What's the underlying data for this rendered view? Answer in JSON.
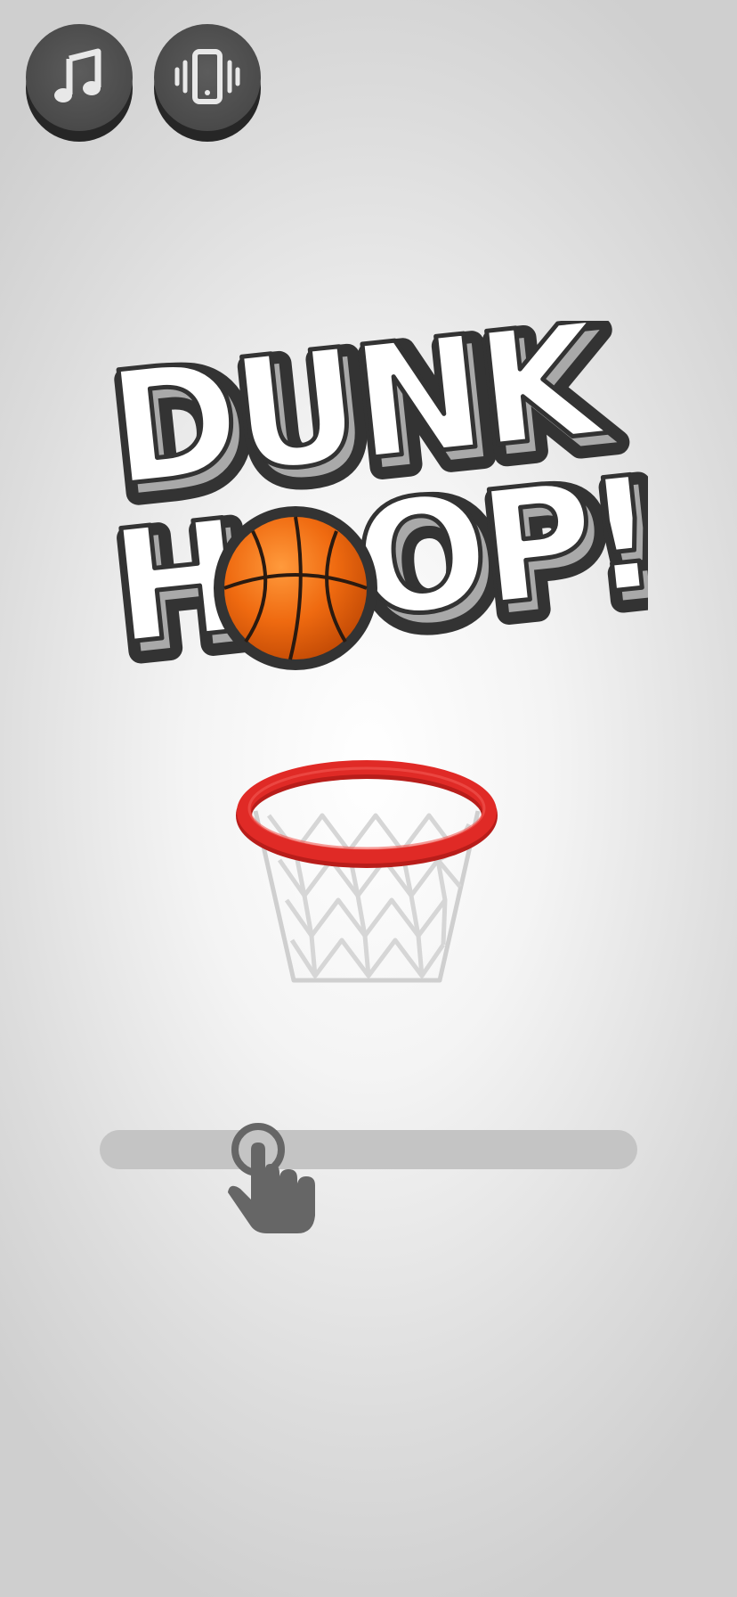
{
  "title": {
    "line1": "DUNK",
    "line2_before": "H",
    "line2_after": "OP!"
  },
  "buttons": {
    "music": {
      "icon": "music-note-icon"
    },
    "vibration": {
      "icon": "vibration-icon"
    }
  },
  "control": {
    "hint_icon": "tap-hand-icon"
  },
  "colors": {
    "button_face": "#4a4a4a",
    "rim": "#e02a26",
    "ball": "#f06a10",
    "logo_outline": "#333333",
    "slider_track": "#c4c4c4"
  }
}
